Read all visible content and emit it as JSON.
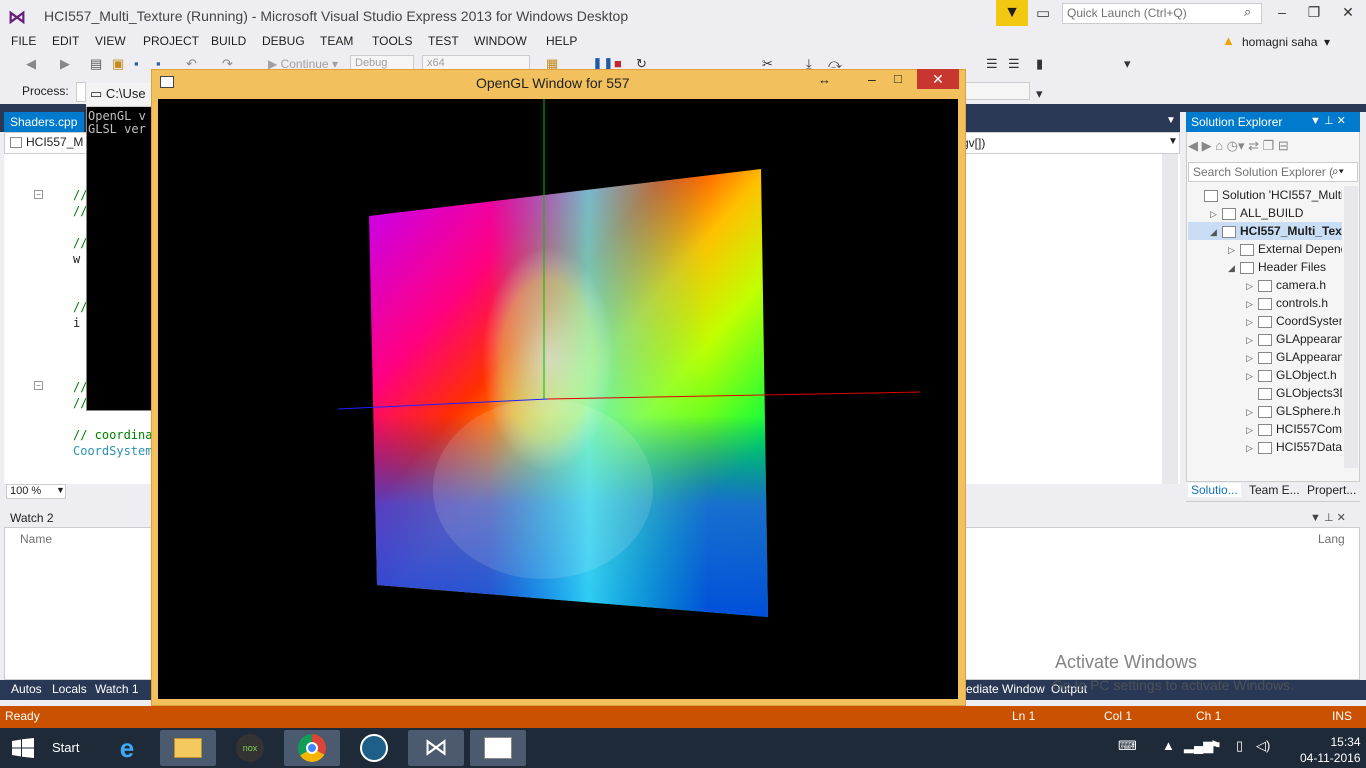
{
  "window": {
    "title": "HCI557_Multi_Texture (Running) - Microsoft Visual Studio Express 2013 for Windows Desktop",
    "quick_launch_placeholder": "Quick Launch (Ctrl+Q)",
    "user": "homagni saha",
    "icons": [
      "visual-studio-logo",
      "filter-icon",
      "feedback-icon",
      "search-icon",
      "minimize-icon",
      "maximize-icon",
      "close-icon"
    ]
  },
  "menu": [
    "FILE",
    "EDIT",
    "VIEW",
    "PROJECT",
    "BUILD",
    "DEBUG",
    "TEAM",
    "TOOLS",
    "TEST",
    "WINDOW",
    "HELP"
  ],
  "toolbar": {
    "continue_label": "Continue",
    "config": "Debug",
    "platform": "x64"
  },
  "process": {
    "label": "Process:"
  },
  "editor": {
    "tab": "Shaders.cpp",
    "nav_left": "HCI557_M",
    "nav_right": "gv[])",
    "zoom": "100 %",
    "code_lines": [
      "//",
      "//",
      "//",
      "w",
      "//",
      "i",
      "//",
      "//",
      "// coordina",
      "CoordSystem"
    ]
  },
  "console": {
    "title": "C:\\Use",
    "lines": [
      "OpenGL v",
      "GLSL ver"
    ]
  },
  "opengl": {
    "title": "OpenGL Window for 557",
    "colors": {
      "frame": "#f2c15d",
      "close": "#c7372f"
    }
  },
  "solution_explorer": {
    "title": "Solution Explorer",
    "search_placeholder": "Search Solution Explorer (",
    "items": [
      {
        "label": "Solution 'HCI557_Multi",
        "level": 0,
        "arrow": "",
        "selected": false
      },
      {
        "label": "ALL_BUILD",
        "level": 1,
        "arrow": "▷",
        "selected": false
      },
      {
        "label": "HCI557_Multi_Text",
        "level": 1,
        "arrow": "◢",
        "selected": true
      },
      {
        "label": "External Depend",
        "level": 2,
        "arrow": "▷",
        "selected": false
      },
      {
        "label": "Header Files",
        "level": 2,
        "arrow": "◢",
        "selected": false
      },
      {
        "label": "camera.h",
        "level": 3,
        "arrow": "▷",
        "selected": false
      },
      {
        "label": "controls.h",
        "level": 3,
        "arrow": "▷",
        "selected": false
      },
      {
        "label": "CoordSystem",
        "level": 3,
        "arrow": "▷",
        "selected": false
      },
      {
        "label": "GLAppearanc",
        "level": 3,
        "arrow": "▷",
        "selected": false
      },
      {
        "label": "GLAppearanc",
        "level": 3,
        "arrow": "▷",
        "selected": false
      },
      {
        "label": "GLObject.h",
        "level": 3,
        "arrow": "▷",
        "selected": false
      },
      {
        "label": "GLObjects3D",
        "level": 3,
        "arrow": "",
        "selected": false
      },
      {
        "label": "GLSphere.h",
        "level": 3,
        "arrow": "▷",
        "selected": false
      },
      {
        "label": "HCI557Comr",
        "level": 3,
        "arrow": "▷",
        "selected": false
      },
      {
        "label": "HCI557Dataty",
        "level": 3,
        "arrow": "▷",
        "selected": false
      }
    ],
    "tabs": [
      "Solutio...",
      "Team E...",
      "Propert..."
    ]
  },
  "watch": {
    "title": "Watch 2",
    "col_name": "Name",
    "col_lang": "Lang"
  },
  "bottom_tabs_left": [
    "Autos",
    "Locals",
    "Watch 1"
  ],
  "bottom_tabs_right": [
    "ediate Window",
    "Output"
  ],
  "activate": {
    "line1": "Activate Windows",
    "line2": "Go to PC settings to activate Windows."
  },
  "status": {
    "state": "Ready",
    "ln": "Ln 1",
    "col": "Col 1",
    "ch": "Ch 1",
    "ins": "INS",
    "color": "#ca5100"
  },
  "taskbar": {
    "start": "Start",
    "time": "15:34",
    "date": "04-11-2016",
    "apps": [
      "internet-explorer-icon",
      "file-explorer-icon",
      "nox-icon",
      "chrome-icon",
      "app-icon",
      "visual-studio-icon",
      "document-icon"
    ]
  }
}
